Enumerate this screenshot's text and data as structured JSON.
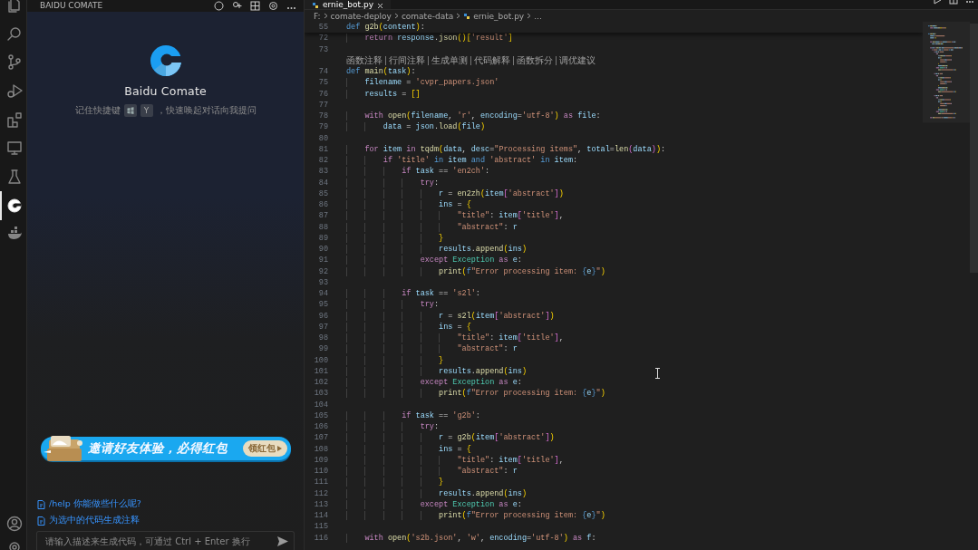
{
  "activity_bar": {
    "items": [
      {
        "kind": "files",
        "selected": false
      },
      {
        "kind": "search",
        "selected": false
      },
      {
        "kind": "source-control",
        "selected": false
      },
      {
        "kind": "run-debug",
        "selected": false
      },
      {
        "kind": "extensions",
        "selected": false
      },
      {
        "kind": "remote",
        "selected": false
      },
      {
        "kind": "testing",
        "selected": false
      },
      {
        "kind": "comate",
        "selected": true
      },
      {
        "kind": "docker",
        "selected": false
      }
    ],
    "bottom": [
      {
        "kind": "account"
      },
      {
        "kind": "settings"
      }
    ]
  },
  "sidebar": {
    "title": "BAIDU COMATE",
    "product_name": "Baidu Comate",
    "shortcut_hint": {
      "before": "记住快捷键",
      "key": "Y",
      "after": "，快速唤起对话向我提问"
    },
    "banner": {
      "text": "邀请好友体验，必得红包",
      "button": "领红包"
    },
    "suggestions": [
      "/help 你能做些什么呢?",
      "为选中的代码生成注释"
    ],
    "input": {
      "placeholder": "请输入描述来生成代码，可通过 Ctrl + Enter 换行"
    }
  },
  "editor": {
    "tab": {
      "label": "ernie_bot.py",
      "selected": true
    },
    "breadcrumb": [
      "F:",
      "comate-deploy",
      "comate-data",
      "ernie_bot.py",
      "..."
    ],
    "sticky_line": {
      "n": "55",
      "tokens": [
        {
          "text": "def ",
          "kind": "kw"
        },
        {
          "text": "g2b",
          "kind": "fn"
        },
        {
          "text": "(",
          "kind": "br1"
        },
        {
          "text": "content",
          "kind": "var"
        },
        {
          "text": ")",
          "kind": "br1"
        },
        {
          "text": ":",
          "kind": "op"
        }
      ]
    },
    "lines": [
      {
        "kind": "code",
        "n": "72",
        "tokens": [
          {
            "text": "    return ",
            "kind": "ctl"
          },
          {
            "text": "response",
            "kind": "var"
          },
          {
            "text": ".",
            "kind": "op"
          },
          {
            "text": "json",
            "kind": "fn"
          },
          {
            "text": "()[",
            "kind": "br1"
          },
          {
            "text": "'result'",
            "kind": "str"
          },
          {
            "text": "]",
            "kind": "br1"
          }
        ]
      },
      {
        "kind": "code",
        "n": "73"
      },
      {
        "kind": "codelens",
        "actions": [
          "函数注释",
          "行间注释",
          "生成单测",
          "代码解释",
          "函数拆分",
          "调优建议"
        ]
      },
      {
        "kind": "code",
        "n": "74",
        "tokens": [
          {
            "text": "def ",
            "kind": "kw"
          },
          {
            "text": "main",
            "kind": "fn"
          },
          {
            "text": "(",
            "kind": "br1"
          },
          {
            "text": "task",
            "kind": "var"
          },
          {
            "text": ")",
            "kind": "br1"
          },
          {
            "text": ":",
            "kind": "op"
          }
        ]
      },
      {
        "kind": "code",
        "n": "75",
        "tokens": [
          {
            "text": "    filename",
            "kind": "var"
          },
          {
            "text": " = ",
            "kind": "op"
          },
          {
            "text": "'cvpr_papers.json'",
            "kind": "str"
          }
        ]
      },
      {
        "kind": "code",
        "n": "76",
        "tokens": [
          {
            "text": "    results",
            "kind": "var"
          },
          {
            "text": " = ",
            "kind": "op"
          },
          {
            "text": "[]",
            "kind": "br1"
          }
        ]
      },
      {
        "kind": "code",
        "n": "77"
      },
      {
        "kind": "code",
        "n": "78",
        "tokens": [
          {
            "text": "    with ",
            "kind": "ctl"
          },
          {
            "text": "open",
            "kind": "fn"
          },
          {
            "text": "(",
            "kind": "br1"
          },
          {
            "text": "filename",
            "kind": "var"
          },
          {
            "text": ", ",
            "kind": "op"
          },
          {
            "text": "'r'",
            "kind": "str"
          },
          {
            "text": ", ",
            "kind": "op"
          },
          {
            "text": "encoding",
            "kind": "var"
          },
          {
            "text": "=",
            "kind": "op"
          },
          {
            "text": "'utf-8'",
            "kind": "str"
          },
          {
            "text": ") ",
            "kind": "br1"
          },
          {
            "text": "as ",
            "kind": "ctl"
          },
          {
            "text": "file",
            "kind": "var"
          },
          {
            "text": ":",
            "kind": "op"
          }
        ]
      },
      {
        "kind": "code",
        "n": "79",
        "tokens": [
          {
            "text": "        data",
            "kind": "var"
          },
          {
            "text": " = ",
            "kind": "op"
          },
          {
            "text": "json",
            "kind": "var"
          },
          {
            "text": ".",
            "kind": "op"
          },
          {
            "text": "load",
            "kind": "fn"
          },
          {
            "text": "(",
            "kind": "br1"
          },
          {
            "text": "file",
            "kind": "var"
          },
          {
            "text": ")",
            "kind": "br1"
          }
        ]
      },
      {
        "kind": "code",
        "n": "80"
      },
      {
        "kind": "code",
        "n": "81",
        "tokens": [
          {
            "text": "    for ",
            "kind": "ctl"
          },
          {
            "text": "item ",
            "kind": "var"
          },
          {
            "text": "in ",
            "kind": "ctl"
          },
          {
            "text": "tqdm",
            "kind": "fn"
          },
          {
            "text": "(",
            "kind": "br1"
          },
          {
            "text": "data",
            "kind": "var"
          },
          {
            "text": ", ",
            "kind": "op"
          },
          {
            "text": "desc",
            "kind": "var"
          },
          {
            "text": "=",
            "kind": "op"
          },
          {
            "text": "\"Processing items\"",
            "kind": "str"
          },
          {
            "text": ", ",
            "kind": "op"
          },
          {
            "text": "total",
            "kind": "var"
          },
          {
            "text": "=",
            "kind": "op"
          },
          {
            "text": "len",
            "kind": "fn"
          },
          {
            "text": "(",
            "kind": "br2"
          },
          {
            "text": "data",
            "kind": "var"
          },
          {
            "text": ")",
            "kind": "br2"
          },
          {
            "text": ")",
            "kind": "br1"
          },
          {
            "text": ":",
            "kind": "op"
          }
        ]
      },
      {
        "kind": "code",
        "n": "82",
        "tokens": [
          {
            "text": "        if ",
            "kind": "ctl"
          },
          {
            "text": "'title' ",
            "kind": "str"
          },
          {
            "text": "in ",
            "kind": "kw"
          },
          {
            "text": "item ",
            "kind": "var"
          },
          {
            "text": "and ",
            "kind": "kw"
          },
          {
            "text": "'abstract' ",
            "kind": "str"
          },
          {
            "text": "in ",
            "kind": "kw"
          },
          {
            "text": "item",
            "kind": "var"
          },
          {
            "text": ":",
            "kind": "op"
          }
        ]
      },
      {
        "kind": "code",
        "n": "83",
        "tokens": [
          {
            "text": "            if ",
            "kind": "ctl"
          },
          {
            "text": "task",
            "kind": "var"
          },
          {
            "text": " == ",
            "kind": "op"
          },
          {
            "text": "'en2ch'",
            "kind": "str"
          },
          {
            "text": ":",
            "kind": "op"
          }
        ]
      },
      {
        "kind": "code",
        "n": "84",
        "tokens": [
          {
            "text": "                try",
            "kind": "ctl"
          },
          {
            "text": ":",
            "kind": "op"
          }
        ]
      },
      {
        "kind": "code",
        "n": "85",
        "tokens": [
          {
            "text": "                    r",
            "kind": "var"
          },
          {
            "text": " = ",
            "kind": "op"
          },
          {
            "text": "en2zh",
            "kind": "fn"
          },
          {
            "text": "(",
            "kind": "br1"
          },
          {
            "text": "item",
            "kind": "var"
          },
          {
            "text": "[",
            "kind": "br2"
          },
          {
            "text": "'abstract'",
            "kind": "str"
          },
          {
            "text": "]",
            "kind": "br2"
          },
          {
            "text": ")",
            "kind": "br1"
          }
        ]
      },
      {
        "kind": "code",
        "n": "86",
        "tokens": [
          {
            "text": "                    ins",
            "kind": "var"
          },
          {
            "text": " = ",
            "kind": "op"
          },
          {
            "text": "{",
            "kind": "br1"
          }
        ]
      },
      {
        "kind": "code",
        "n": "87",
        "tokens": [
          {
            "text": "                        \"title\"",
            "kind": "str"
          },
          {
            "text": ": ",
            "kind": "op"
          },
          {
            "text": "item",
            "kind": "var"
          },
          {
            "text": "[",
            "kind": "br2"
          },
          {
            "text": "'title'",
            "kind": "str"
          },
          {
            "text": "]",
            "kind": "br2"
          },
          {
            "text": ",",
            "kind": "op"
          }
        ]
      },
      {
        "kind": "code",
        "n": "88",
        "tokens": [
          {
            "text": "                        \"abstract\"",
            "kind": "str"
          },
          {
            "text": ": ",
            "kind": "op"
          },
          {
            "text": "r",
            "kind": "var"
          }
        ]
      },
      {
        "kind": "code",
        "n": "89",
        "tokens": [
          {
            "text": "                    }",
            "kind": "br1"
          }
        ]
      },
      {
        "kind": "code",
        "n": "90",
        "tokens": [
          {
            "text": "                    results",
            "kind": "var"
          },
          {
            "text": ".",
            "kind": "op"
          },
          {
            "text": "append",
            "kind": "fn"
          },
          {
            "text": "(",
            "kind": "br1"
          },
          {
            "text": "ins",
            "kind": "var"
          },
          {
            "text": ")",
            "kind": "br1"
          }
        ]
      },
      {
        "kind": "code",
        "n": "91",
        "tokens": [
          {
            "text": "                except ",
            "kind": "ctl"
          },
          {
            "text": "Exception ",
            "kind": "cls"
          },
          {
            "text": "as ",
            "kind": "ctl"
          },
          {
            "text": "e",
            "kind": "var"
          },
          {
            "text": ":",
            "kind": "op"
          }
        ]
      },
      {
        "kind": "code",
        "n": "92",
        "tokens": [
          {
            "text": "                    print",
            "kind": "fn"
          },
          {
            "text": "(",
            "kind": "br1"
          },
          {
            "text": "f",
            "kind": "kw"
          },
          {
            "text": "\"Error processing item: ",
            "kind": "str"
          },
          {
            "text": "{",
            "kind": "kw"
          },
          {
            "text": "e",
            "kind": "var"
          },
          {
            "text": "}",
            "kind": "kw"
          },
          {
            "text": "\"",
            "kind": "str"
          },
          {
            "text": ")",
            "kind": "br1"
          }
        ]
      },
      {
        "kind": "code",
        "n": "93"
      },
      {
        "kind": "code",
        "n": "94",
        "tokens": [
          {
            "text": "            if ",
            "kind": "ctl"
          },
          {
            "text": "task",
            "kind": "var"
          },
          {
            "text": " == ",
            "kind": "op"
          },
          {
            "text": "'s2l'",
            "kind": "str"
          },
          {
            "text": ":",
            "kind": "op"
          }
        ]
      },
      {
        "kind": "code",
        "n": "95",
        "tokens": [
          {
            "text": "                try",
            "kind": "ctl"
          },
          {
            "text": ":",
            "kind": "op"
          }
        ]
      },
      {
        "kind": "code",
        "n": "96",
        "tokens": [
          {
            "text": "                    r",
            "kind": "var"
          },
          {
            "text": " = ",
            "kind": "op"
          },
          {
            "text": "s2l",
            "kind": "fn"
          },
          {
            "text": "(",
            "kind": "br1"
          },
          {
            "text": "item",
            "kind": "var"
          },
          {
            "text": "[",
            "kind": "br2"
          },
          {
            "text": "'abstract'",
            "kind": "str"
          },
          {
            "text": "]",
            "kind": "br2"
          },
          {
            "text": ")",
            "kind": "br1"
          }
        ]
      },
      {
        "kind": "code",
        "n": "97",
        "tokens": [
          {
            "text": "                    ins",
            "kind": "var"
          },
          {
            "text": " = ",
            "kind": "op"
          },
          {
            "text": "{",
            "kind": "br1"
          }
        ]
      },
      {
        "kind": "code",
        "n": "98",
        "tokens": [
          {
            "text": "                        \"title\"",
            "kind": "str"
          },
          {
            "text": ": ",
            "kind": "op"
          },
          {
            "text": "item",
            "kind": "var"
          },
          {
            "text": "[",
            "kind": "br2"
          },
          {
            "text": "'title'",
            "kind": "str"
          },
          {
            "text": "]",
            "kind": "br2"
          },
          {
            "text": ",",
            "kind": "op"
          }
        ]
      },
      {
        "kind": "code",
        "n": "99",
        "tokens": [
          {
            "text": "                        \"abstract\"",
            "kind": "str"
          },
          {
            "text": ": ",
            "kind": "op"
          },
          {
            "text": "r",
            "kind": "var"
          }
        ]
      },
      {
        "kind": "code",
        "n": "100",
        "tokens": [
          {
            "text": "                    }",
            "kind": "br1"
          }
        ]
      },
      {
        "kind": "code",
        "n": "101",
        "tokens": [
          {
            "text": "                    results",
            "kind": "var"
          },
          {
            "text": ".",
            "kind": "op"
          },
          {
            "text": "append",
            "kind": "fn"
          },
          {
            "text": "(",
            "kind": "br1"
          },
          {
            "text": "ins",
            "kind": "var"
          },
          {
            "text": ")",
            "kind": "br1"
          }
        ]
      },
      {
        "kind": "code",
        "n": "102",
        "tokens": [
          {
            "text": "                except ",
            "kind": "ctl"
          },
          {
            "text": "Exception ",
            "kind": "cls"
          },
          {
            "text": "as ",
            "kind": "ctl"
          },
          {
            "text": "e",
            "kind": "var"
          },
          {
            "text": ":",
            "kind": "op"
          }
        ]
      },
      {
        "kind": "code",
        "n": "103",
        "tokens": [
          {
            "text": "                    print",
            "kind": "fn"
          },
          {
            "text": "(",
            "kind": "br1"
          },
          {
            "text": "f",
            "kind": "kw"
          },
          {
            "text": "\"Error processing item: ",
            "kind": "str"
          },
          {
            "text": "{",
            "kind": "kw"
          },
          {
            "text": "e",
            "kind": "var"
          },
          {
            "text": "}",
            "kind": "kw"
          },
          {
            "text": "\"",
            "kind": "str"
          },
          {
            "text": ")",
            "kind": "br1"
          }
        ]
      },
      {
        "kind": "code",
        "n": "104"
      },
      {
        "kind": "code",
        "n": "105",
        "tokens": [
          {
            "text": "            if ",
            "kind": "ctl"
          },
          {
            "text": "task",
            "kind": "var"
          },
          {
            "text": " == ",
            "kind": "op"
          },
          {
            "text": "'g2b'",
            "kind": "str"
          },
          {
            "text": ":",
            "kind": "op"
          }
        ]
      },
      {
        "kind": "code",
        "n": "106",
        "tokens": [
          {
            "text": "                try",
            "kind": "ctl"
          },
          {
            "text": ":",
            "kind": "op"
          }
        ]
      },
      {
        "kind": "code",
        "n": "107",
        "tokens": [
          {
            "text": "                    r",
            "kind": "var"
          },
          {
            "text": " = ",
            "kind": "op"
          },
          {
            "text": "g2b",
            "kind": "fn"
          },
          {
            "text": "(",
            "kind": "br1"
          },
          {
            "text": "item",
            "kind": "var"
          },
          {
            "text": "[",
            "kind": "br2"
          },
          {
            "text": "'abstract'",
            "kind": "str"
          },
          {
            "text": "]",
            "kind": "br2"
          },
          {
            "text": ")",
            "kind": "br1"
          }
        ]
      },
      {
        "kind": "code",
        "n": "108",
        "tokens": [
          {
            "text": "                    ins",
            "kind": "var"
          },
          {
            "text": " = ",
            "kind": "op"
          },
          {
            "text": "{",
            "kind": "br1"
          }
        ]
      },
      {
        "kind": "code",
        "n": "109",
        "tokens": [
          {
            "text": "                        \"title\"",
            "kind": "str"
          },
          {
            "text": ": ",
            "kind": "op"
          },
          {
            "text": "item",
            "kind": "var"
          },
          {
            "text": "[",
            "kind": "br2"
          },
          {
            "text": "'title'",
            "kind": "str"
          },
          {
            "text": "]",
            "kind": "br2"
          },
          {
            "text": ",",
            "kind": "op"
          }
        ]
      },
      {
        "kind": "code",
        "n": "110",
        "tokens": [
          {
            "text": "                        \"abstract\"",
            "kind": "str"
          },
          {
            "text": ": ",
            "kind": "op"
          },
          {
            "text": "r",
            "kind": "var"
          }
        ]
      },
      {
        "kind": "code",
        "n": "111",
        "tokens": [
          {
            "text": "                    }",
            "kind": "br1"
          }
        ]
      },
      {
        "kind": "code",
        "n": "112",
        "tokens": [
          {
            "text": "                    results",
            "kind": "var"
          },
          {
            "text": ".",
            "kind": "op"
          },
          {
            "text": "append",
            "kind": "fn"
          },
          {
            "text": "(",
            "kind": "br1"
          },
          {
            "text": "ins",
            "kind": "var"
          },
          {
            "text": ")",
            "kind": "br1"
          }
        ]
      },
      {
        "kind": "code",
        "n": "113",
        "tokens": [
          {
            "text": "                except ",
            "kind": "ctl"
          },
          {
            "text": "Exception ",
            "kind": "cls"
          },
          {
            "text": "as ",
            "kind": "ctl"
          },
          {
            "text": "e",
            "kind": "var"
          },
          {
            "text": ":",
            "kind": "op"
          }
        ]
      },
      {
        "kind": "code",
        "n": "114",
        "tokens": [
          {
            "text": "                    print",
            "kind": "fn"
          },
          {
            "text": "(",
            "kind": "br1"
          },
          {
            "text": "f",
            "kind": "kw"
          },
          {
            "text": "\"Error processing item: ",
            "kind": "str"
          },
          {
            "text": "{",
            "kind": "kw"
          },
          {
            "text": "e",
            "kind": "var"
          },
          {
            "text": "}",
            "kind": "kw"
          },
          {
            "text": "\"",
            "kind": "str"
          },
          {
            "text": ")",
            "kind": "br1"
          }
        ]
      },
      {
        "kind": "code",
        "n": "115"
      },
      {
        "kind": "code",
        "n": "116",
        "tokens": [
          {
            "text": "    with ",
            "kind": "ctl"
          },
          {
            "text": "open",
            "kind": "fn"
          },
          {
            "text": "(",
            "kind": "br1"
          },
          {
            "text": "'s2b.json'",
            "kind": "str"
          },
          {
            "text": ", ",
            "kind": "op"
          },
          {
            "text": "'w'",
            "kind": "str"
          },
          {
            "text": ", ",
            "kind": "op"
          },
          {
            "text": "encoding",
            "kind": "var"
          },
          {
            "text": "=",
            "kind": "op"
          },
          {
            "text": "'utf-8'",
            "kind": "str"
          },
          {
            "text": ") ",
            "kind": "br1"
          },
          {
            "text": "as ",
            "kind": "ctl"
          },
          {
            "text": "f",
            "kind": "var"
          },
          {
            "text": ":",
            "kind": "op"
          }
        ]
      }
    ]
  }
}
